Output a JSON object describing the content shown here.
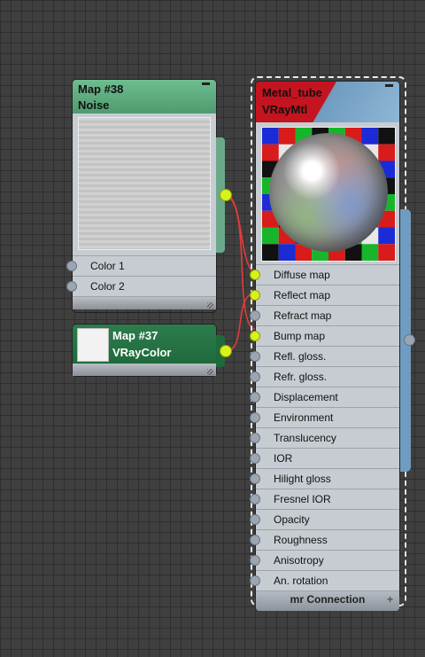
{
  "colors": {
    "noise_header": "#4f9b70",
    "vraycolor_header": "#1f6a3c",
    "material_header_left": "#c4141f",
    "material_header_right": "#6f9cc0",
    "active_socket": "#d8f21b",
    "wire": "#e23b3b"
  },
  "noise_node": {
    "name": "Map #38",
    "type": "Noise",
    "slots": [
      "Color 1",
      "Color 2"
    ]
  },
  "vraycolor_node": {
    "name": "Map #37",
    "type": "VRayColor"
  },
  "material_node": {
    "name": "Metal_tube",
    "type": "VRayMtl",
    "slots": [
      {
        "label": "Diffuse map",
        "connected": true
      },
      {
        "label": "Reflect map",
        "connected": true
      },
      {
        "label": "Refract map",
        "connected": false
      },
      {
        "label": "Bump map",
        "connected": true
      },
      {
        "label": "Refl. gloss.",
        "connected": false
      },
      {
        "label": "Refr. gloss.",
        "connected": false
      },
      {
        "label": "Displacement",
        "connected": false
      },
      {
        "label": "Environment",
        "connected": false
      },
      {
        "label": "Translucency",
        "connected": false
      },
      {
        "label": "IOR",
        "connected": false
      },
      {
        "label": "Hilight gloss",
        "connected": false
      },
      {
        "label": "Fresnel IOR",
        "connected": false
      },
      {
        "label": "Opacity",
        "connected": false
      },
      {
        "label": "Roughness",
        "connected": false
      },
      {
        "label": "Anisotropy",
        "connected": false
      },
      {
        "label": "An. rotation",
        "connected": false
      }
    ],
    "footer": "mr Connection",
    "footer_icon": "plus-icon"
  }
}
